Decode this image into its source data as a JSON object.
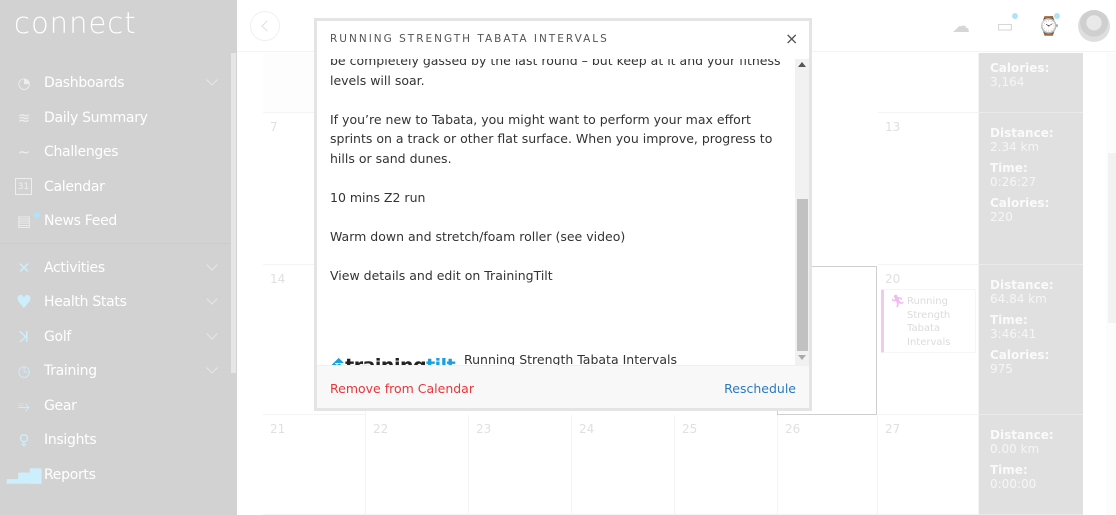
{
  "app": {
    "logo": "connect"
  },
  "sidebar": {
    "items": [
      {
        "label": "Dashboards",
        "icon": "gauge-icon",
        "chevron": true
      },
      {
        "label": "Daily Summary",
        "icon": "layers-icon",
        "chevron": false
      },
      {
        "label": "Challenges",
        "icon": "trend-icon",
        "chevron": false
      },
      {
        "label": "Calendar",
        "icon": "calendar-icon",
        "chevron": false,
        "icon_text": "31"
      },
      {
        "label": "News Feed",
        "icon": "newsfeed-icon",
        "chevron": false,
        "badge": true
      },
      {
        "label": "Activities",
        "icon": "person-icon",
        "chevron": true
      },
      {
        "label": "Health Stats",
        "icon": "heart-icon",
        "chevron": true
      },
      {
        "label": "Golf",
        "icon": "golfer-icon",
        "chevron": true
      },
      {
        "label": "Training",
        "icon": "stopwatch-icon",
        "chevron": true
      },
      {
        "label": "Gear",
        "icon": "shoe-icon",
        "chevron": false
      },
      {
        "label": "Insights",
        "icon": "lightbulb-icon",
        "chevron": false
      },
      {
        "label": "Reports",
        "icon": "bar-chart-icon",
        "chevron": false
      }
    ]
  },
  "topbar": {
    "icons": [
      "upload-cloud-icon",
      "inbox-icon",
      "watch-icon",
      "avatar"
    ]
  },
  "calendar": {
    "rows": [
      {
        "days": [
          "",
          "",
          "",
          "",
          "",
          "",
          ""
        ],
        "summary": {
          "calories_label": "Calories:",
          "calories": "3,164"
        }
      },
      {
        "days": [
          "7",
          "",
          "",
          "",
          "",
          "",
          "13"
        ],
        "summary": {
          "distance_label": "Distance:",
          "distance": "2.34 km",
          "time_label": "Time:",
          "time": "0:26:27",
          "calories_label": "Calories:",
          "calories": "220"
        }
      },
      {
        "days": [
          "14",
          "",
          "",
          "",
          "",
          "",
          "20"
        ],
        "summary": {
          "distance_label": "Distance:",
          "distance": "64.84 km",
          "time_label": "Time:",
          "time": "3:46:41",
          "calories_label": "Calories:",
          "calories": "975"
        }
      },
      {
        "days": [
          "21",
          "22",
          "23",
          "24",
          "25",
          "26",
          "27"
        ],
        "summary": {
          "distance_label": "Distance:",
          "distance": "0.00 km",
          "time_label": "Time:",
          "time": "0:00:00"
        }
      }
    ],
    "event": {
      "title": "Running Strength Tabata Intervals",
      "icon": "running-icon",
      "color": "#f0c9ee"
    }
  },
  "modal": {
    "title": "RUNNING STRENGTH TABATA INTERVALS",
    "close": "×",
    "paragraphs": [
      "be completely gassed by the last round – but keep at it and your fitness levels will soar.",
      "If you’re new to Tabata, you might want to perform your max effort sprints on a track or other flat surface. When you improve, progress to hills or sand dunes.",
      "10 mins Z2 run",
      "Warm down and stretch/foam roller (see video)",
      "View details and edit on TrainingTilt"
    ],
    "provider": {
      "logo_main": "training",
      "logo_accent": "tilt.",
      "workout_name": "Running Strength Tabata Intervals",
      "brand": "TrainingTilt"
    },
    "footer": {
      "remove": "Remove from Calendar",
      "reschedule": "Reschedule"
    },
    "colors": {
      "remove": "#e8363a",
      "reschedule": "#2a7abf",
      "brand": "#1aa0dc"
    }
  }
}
